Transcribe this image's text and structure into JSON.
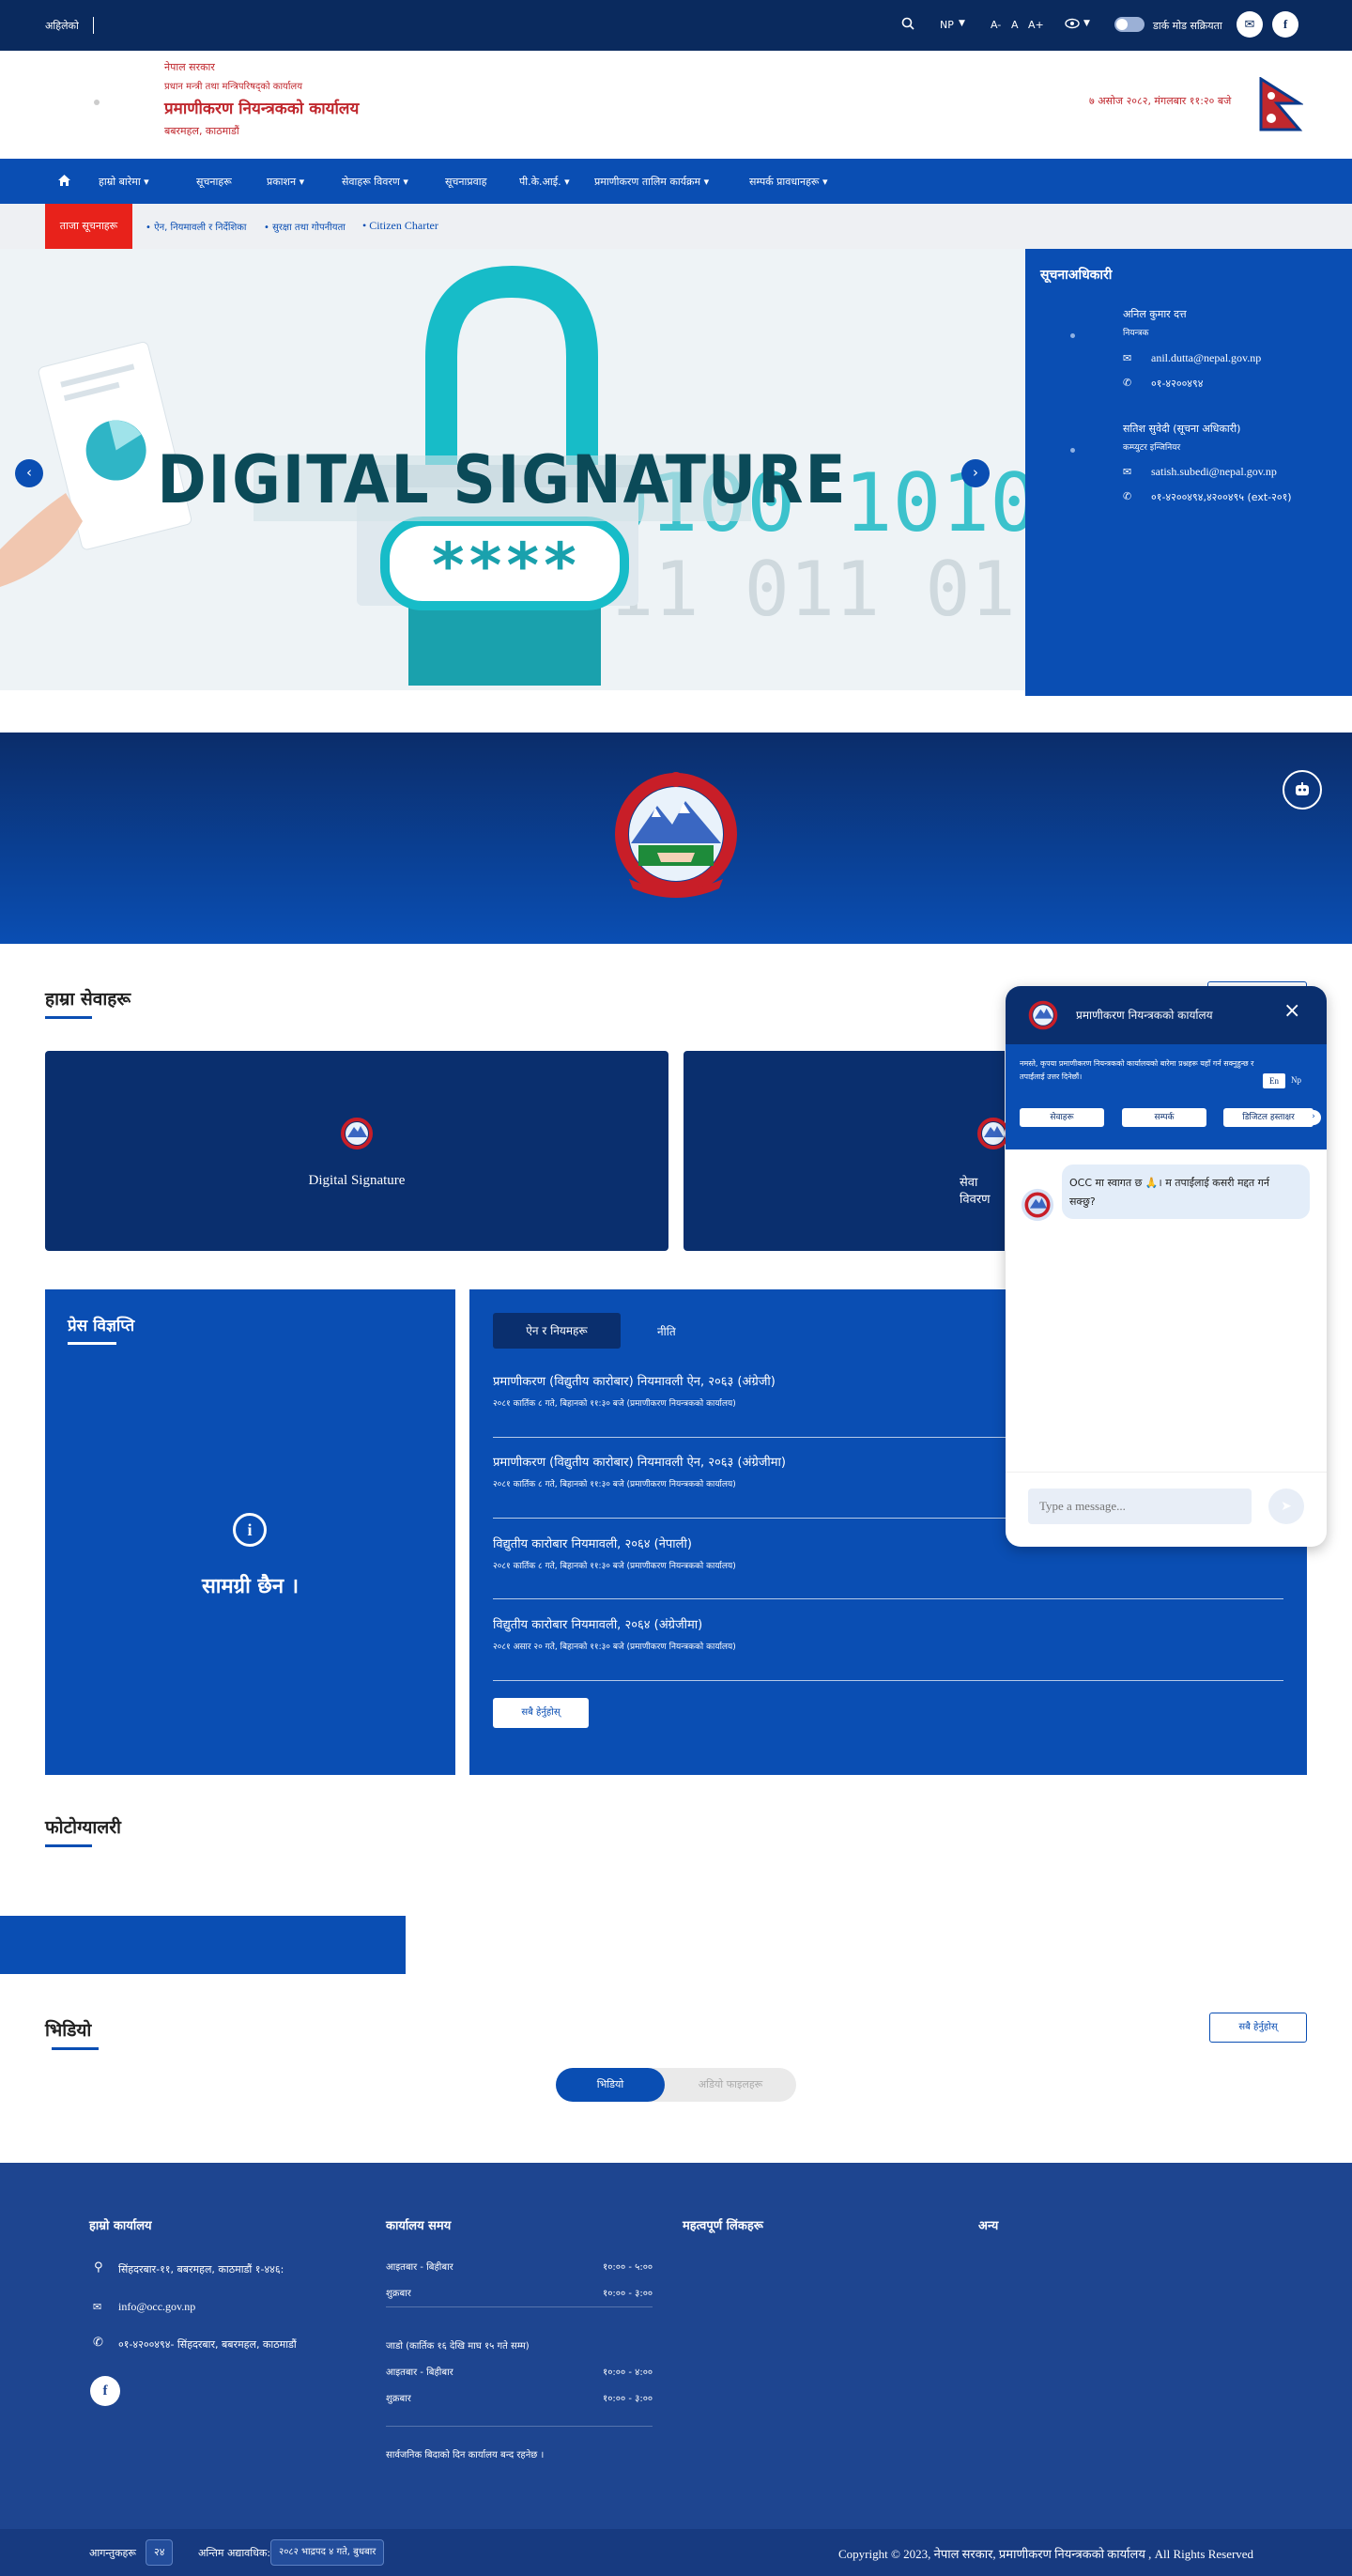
{
  "topbar": {
    "left_label": "अहिलेको",
    "lang": "NP",
    "font_small": "A-",
    "font_normal": "A",
    "font_large": "A+",
    "dark_mode_label": "डार्क मोड सक्रियता"
  },
  "header": {
    "gov_line1": "नेपाल सरकार",
    "gov_line2": "प्रधान मन्त्री तथा मन्त्रिपरिषद्को कार्यालय",
    "office_name": "प्रमाणीकरण नियन्त्रकको कार्यालय",
    "office_location": "बबरमहल, काठमाडौं",
    "date_time": "७ असोज २०८२, मंगलबार ११:२० बजे"
  },
  "nav": {
    "items": [
      "हाम्रो बारेमा",
      "सूचनाहरू",
      "प्रकाशन",
      "सेवाहरू विवरण",
      "सूचनाप्रवाह",
      "पी.के.आई.",
      "प्रमाणीकरण तालिम कार्यक्रम",
      "सम्पर्क प्रावधानहरू"
    ]
  },
  "ticker": {
    "badge": "ताजा सूचनाहरू",
    "items": [
      "ऐन, नियमावली र निर्देशिका",
      "सुरक्षा तथा गोपनीयता",
      "Citizen Charter"
    ]
  },
  "slider": {
    "title": "DIGITAL SIGNATURE",
    "password_text": "****",
    "binary_row1": "0100 1010",
    "binary_row2": "011 011 01"
  },
  "contact": {
    "heading": "सूचनाअधिकारी",
    "persons": [
      {
        "name": "अनिल कुमार दत्त",
        "role": "नियन्त्रक",
        "email": "anil.dutta@nepal.gov.np",
        "phone": "०१-४२००४९४"
      },
      {
        "name": "सतिश सुवेदी (सूचना अधिकारी)",
        "role": "कम्प्युटर इन्जिनियर",
        "email": "satish.subedi@nepal.gov.np",
        "phone": "०१-४२००४९४,४२००४९५ (ext-२०१)"
      }
    ]
  },
  "services": {
    "heading": "हाम्रा सेवाहरू",
    "cards": [
      "Digital Signature",
      "सेवा विवरण"
    ]
  },
  "notice_left": {
    "heading": "प्रेस विज्ञप्ति",
    "empty_text": "सामग्री छैन ।"
  },
  "notice_right": {
    "tabs": [
      "ऐन र नियमहरू",
      "नीति"
    ],
    "items": [
      {
        "title": "प्रमाणीकरण (विद्युतीय कारोबार) नियमावली ऐन, २०६३ (अंग्रेजी)",
        "date": "२०८१ कार्तिक ८ गते, बिहानको ११:३० बजे (प्रमाणीकरण नियन्त्रकको कार्यालय)"
      },
      {
        "title": "प्रमाणीकरण (विद्युतीय कारोबार) नियमावली ऐन, २०६३ (अंग्रेजीमा)",
        "date": "२०८१ कार्तिक ८ गते, बिहानको ११:३० बजे (प्रमाणीकरण नियन्त्रकको कार्यालय)"
      },
      {
        "title": "विद्युतीय कारोबार नियमावली, २०६४ (नेपाली)",
        "date": "२०८१ कार्तिक ८ गते, बिहानको ११:३० बजे (प्रमाणीकरण नियन्त्रकको कार्यालय)"
      },
      {
        "title": "विद्युतीय कारोबार नियमावली, २०६४ (अंग्रेजीमा)",
        "date": "२०८१ असार २० गते, बिहानको ११:३० बजे (प्रमाणीकरण नियन्त्रकको कार्यालय)"
      }
    ],
    "view_all": "सबै हेर्नुहोस्"
  },
  "gallery": {
    "heading": "फोटोग्यालरी"
  },
  "video": {
    "heading": "भिडियो",
    "view_all": "सबै हेर्नुहोस्",
    "toggle": [
      "भिडियो",
      "अडियो फाइलहरू"
    ]
  },
  "chat": {
    "title": "प्रमाणीकरण नियन्त्रकको कार्यालय",
    "intro": "नमस्ते, कृपया प्रमाणीकरण नियन्त्रकको कार्यालयको बारेमा प्रश्नहरू यहाँ गर्न सक्नुहुन्छ र तपाईंलाई उत्तर दिनेछौं।",
    "lang_en": "En",
    "lang_np": "Np",
    "chips": [
      "सेवाहरू",
      "सम्पर्क",
      "डिजिटल हस्ताक्षर"
    ],
    "message": "OCC मा स्वागत छ 🙏। म तपाईंलाई कसरी मद्दत गर्न सक्छु?",
    "input_placeholder": "Type a message..."
  },
  "footer": {
    "office_heading": "हाम्रो कार्यालय",
    "address": "सिंहदरबार-११, बबरमहल, काठमाडौं १-४४६:",
    "email": "info@occ.gov.np",
    "phone": "०१-४२००४९४- सिंहदरबार, बबरमहल, काठमाडौं",
    "hours_heading": "कार्यालय समय",
    "summer_rows": [
      {
        "day": "आइतबार - बिहीबार",
        "time": "१०:०० - ५:००"
      },
      {
        "day": "शुक्रबार",
        "time": "१०:०० - ३:००"
      }
    ],
    "winter_label": "जाडो (कार्तिक १६ देखि माघ १५ गते सम्म)",
    "winter_rows": [
      {
        "day": "आइतबार - बिहीबार",
        "time": "१०:०० - ४:००"
      },
      {
        "day": "शुक्रबार",
        "time": "१०:०० - ३:००"
      }
    ],
    "holiday_note": "सार्वजनिक बिदाको दिन कार्यालय बन्द रहनेछ ।",
    "links_heading": "महत्वपूर्ण लिंकहरू",
    "other_heading": "अन्य"
  },
  "footer_bottom": {
    "visitor_label": "आगन्तुकहरू",
    "visitor_count": "२४",
    "updated_label": "अन्तिम अद्यावधिक:",
    "updated_value": "२०८२ भाद्रपद ४ गते, बुधबार",
    "copyright": "Copyright © 2023, नेपाल सरकार, प्रमाणीकरण नियन्त्रकको कार्यालय , All Rights Reserved"
  }
}
